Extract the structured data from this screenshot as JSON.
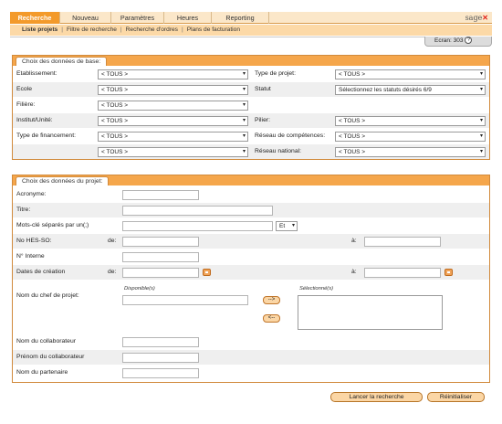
{
  "nav": {
    "tabs": [
      {
        "label": "Recherche"
      },
      {
        "label": "Nouveau"
      },
      {
        "label": "Paramètres"
      },
      {
        "label": "Heures"
      },
      {
        "label": "Reporting"
      }
    ],
    "logo": "sage",
    "sub": [
      {
        "label": "Liste projets"
      },
      {
        "label": "Filtre de recherche"
      },
      {
        "label": "Recherche d'ordres"
      },
      {
        "label": "Plans de facturation"
      }
    ],
    "screen": "Ecran: 303"
  },
  "base": {
    "title": "Choix des données de base:",
    "etablissement": {
      "label": "Etablissement:",
      "value": "< TOUS >"
    },
    "type_projet": {
      "label": "Type de projet:",
      "value": "< TOUS >"
    },
    "ecole": {
      "label": "Ecole",
      "value": "< TOUS >"
    },
    "statut": {
      "label": "Statut",
      "value": "Sélectionnez les statuts désirés 6/9"
    },
    "filiere": {
      "label": "Filière:",
      "value": "< TOUS >"
    },
    "institut": {
      "label": "Institut/Unité:",
      "value": "< TOUS >"
    },
    "pilier": {
      "label": "Pilier:",
      "value": "< TOUS >"
    },
    "financement": {
      "label": "Type de financement:",
      "value": "< TOUS >"
    },
    "reseau_comp": {
      "label": "Réseau de compétences:",
      "value": "< TOUS >"
    },
    "financement2": {
      "value": "< TOUS >"
    },
    "reseau_nat": {
      "label": "Réseau national:",
      "value": "< TOUS >"
    }
  },
  "projet": {
    "title": "Choix des données du projet:",
    "acronyme": "Acronyme:",
    "titre": "Titre:",
    "motscles": "Mots-clé séparés par un(;)",
    "et_value": "Et",
    "no_hes": "No HES-SO:",
    "de": "de:",
    "a": "à:",
    "no_interne": "N° Interne",
    "dates": "Dates de création",
    "chef": "Nom du chef de projet:",
    "disponible": "Disponible(s)",
    "selectionne": "Sélectionné(s)",
    "add": "-->",
    "remove": "<--",
    "collab_nom": "Nom du collaborateur",
    "collab_prenom": "Prénom du collaborateur",
    "partenaire": "Nom du partenaire"
  },
  "actions": {
    "search": "Lancer la recherche",
    "reset": "Réinitialiser"
  },
  "colors": {
    "accent": "#f39a2b",
    "panel_head": "#f5a64b",
    "subnav": "#fcd9a7"
  }
}
